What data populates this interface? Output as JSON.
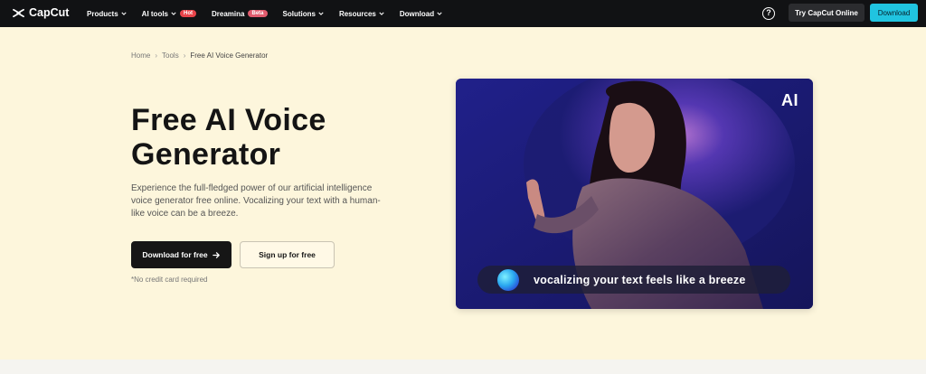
{
  "nav": {
    "logo_text": "CapCut",
    "items": [
      {
        "label": "Products",
        "has_chevron": true
      },
      {
        "label": "AI tools",
        "has_chevron": true,
        "badge": "Hot"
      },
      {
        "label": "Dreamina",
        "has_chevron": false,
        "badge": "Beta"
      },
      {
        "label": "Solutions",
        "has_chevron": true
      },
      {
        "label": "Resources",
        "has_chevron": true
      },
      {
        "label": "Download",
        "has_chevron": true
      }
    ],
    "help_icon": "?",
    "try_label": "Try CapCut Online",
    "download_label": "Download"
  },
  "breadcrumb": {
    "items": [
      "Home",
      "Tools",
      "Free AI Voice Generator"
    ]
  },
  "hero": {
    "title": "Free AI Voice Generator",
    "description": "Experience the full-fledged power of our artificial intelligence voice generator free online. Vocalizing your text with a human-like voice can be a breeze.",
    "primary_cta": "Download for free",
    "secondary_cta": "Sign up for free",
    "note": "*No credit card required",
    "image": {
      "ai_label": "AI",
      "caption": "vocalizing your text feels like a breeze"
    }
  },
  "colors": {
    "nav_bg": "#111214",
    "accent": "#20c4e0",
    "hot_badge": "#e8444a",
    "page_bg": "#fdf6dc"
  }
}
